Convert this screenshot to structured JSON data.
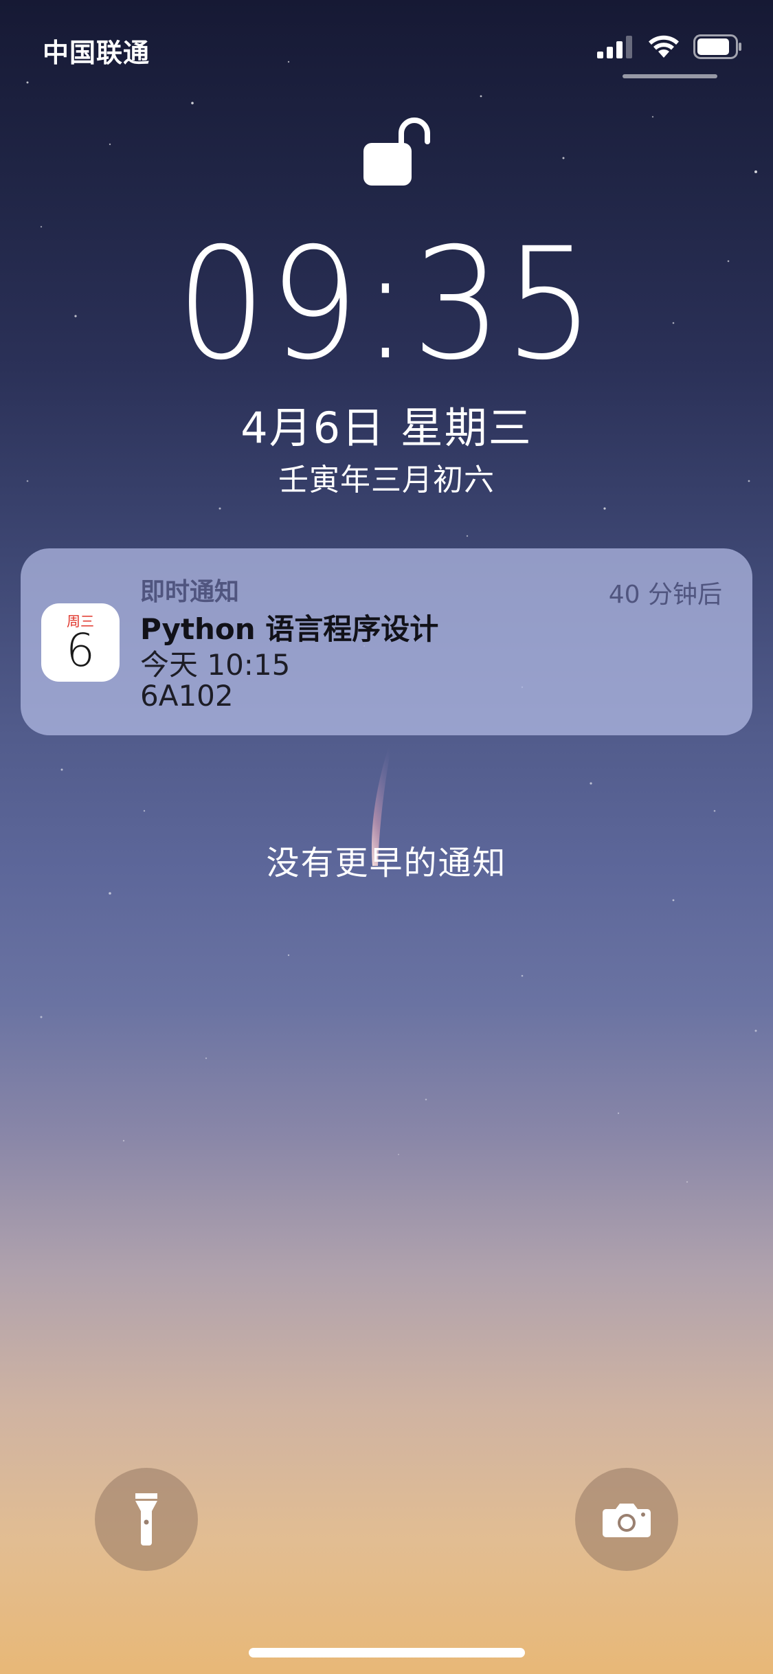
{
  "status_bar": {
    "carrier": "中国联通",
    "signal_icon": "cellular-signal-icon",
    "wifi_icon": "wifi-icon",
    "battery_icon": "battery-icon"
  },
  "lock_screen": {
    "lock_icon": "unlocked-padlock-icon",
    "time": "09:35",
    "date": "4月6日 星期三",
    "lunar_date": "壬寅年三月初六"
  },
  "notification": {
    "app_name": "即时通知",
    "relative_time": "40 分钟后",
    "icon": {
      "name": "calendar-icon",
      "weekday": "周三",
      "day": "6"
    },
    "title": "Python 语言程序设计",
    "line1": "今天 10:15",
    "line2": "6A102"
  },
  "no_older_notifications": "没有更早的通知",
  "quick_actions": {
    "flashlight_icon": "flashlight-icon",
    "camera_icon": "camera-icon"
  },
  "colors": {
    "notification_bg": "#b4bce6",
    "app_name_color": "#50557f",
    "calendar_accent": "#e0352b"
  }
}
